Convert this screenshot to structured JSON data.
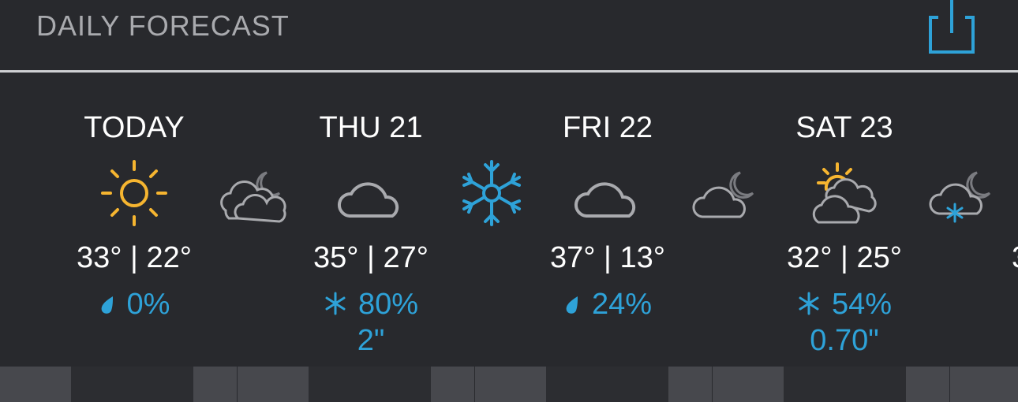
{
  "header": {
    "title": "DAILY FORECAST",
    "share_icon": "share-icon"
  },
  "colors": {
    "background": "#28292d",
    "accent_blue": "#2ea2d8",
    "sun_yellow": "#f6b530",
    "cloud_gray": "#a9aaae"
  },
  "days": [
    {
      "label": "TODAY",
      "day_icon": "sun-icon",
      "night_icon": "partly-cloudy-night-icon",
      "temps": "33° | 22°",
      "precip_icon": "raindrop-icon",
      "precip": "0%",
      "accum": ""
    },
    {
      "label": "THU 21",
      "day_icon": "cloud-icon",
      "night_icon": "snowflake-icon",
      "temps": "35° | 27°",
      "precip_icon": "snowflake-small-icon",
      "precip": "80%",
      "accum": "2\""
    },
    {
      "label": "FRI 22",
      "day_icon": "cloud-icon",
      "night_icon": "partly-cloudy-night-icon",
      "temps": "37° | 13°",
      "precip_icon": "raindrop-icon",
      "precip": "24%",
      "accum": ""
    },
    {
      "label": "SAT 23",
      "day_icon": "partly-sunny-icon",
      "night_icon": "snow-night-icon",
      "temps": "32° | 25°",
      "precip_icon": "snowflake-small-icon",
      "precip": "54%",
      "accum": "0.70\""
    }
  ],
  "partial_next_temp": "3"
}
